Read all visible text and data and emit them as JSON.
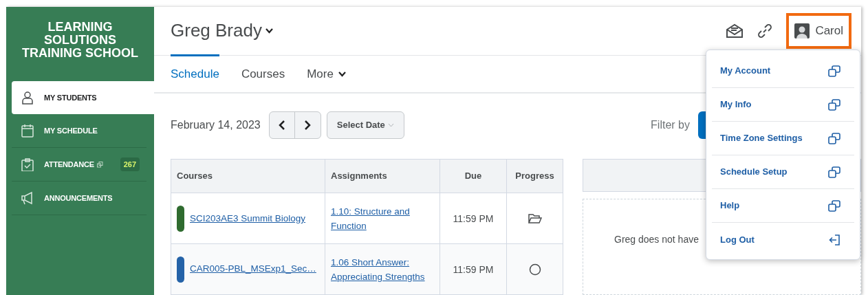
{
  "sidebar": {
    "logo": "LEARNING SOLUTIONS TRAINING SCHOOL",
    "items": [
      {
        "label": "MY STUDENTS",
        "kind": "person",
        "selected": true
      },
      {
        "label": "MY SCHEDULE",
        "kind": "calendar",
        "selected": false
      },
      {
        "label": "ATTENDANCE",
        "kind": "clipboard",
        "selected": false,
        "external": true,
        "badge": "267"
      },
      {
        "label": "ANNOUNCEMENTS",
        "kind": "megaphone",
        "selected": false
      }
    ]
  },
  "header": {
    "student": "Greg Brady",
    "user": "Carol",
    "user_highlighted": true
  },
  "tabs": [
    {
      "label": "Schedule",
      "selected": true,
      "dropdown": false
    },
    {
      "label": "Courses",
      "selected": false,
      "dropdown": false
    },
    {
      "label": "More",
      "selected": false,
      "dropdown": true
    }
  ],
  "toolbar": {
    "date": "February 14, 2023",
    "select_date": "Select Date",
    "filter_label": "Filter by"
  },
  "table": {
    "columns": [
      "Courses",
      "Assignments",
      "Due",
      "Progress"
    ],
    "rows": [
      {
        "course": "SCI203AE3 Summit Biology",
        "color": "#2f6b2f",
        "assignment": "1.10: Structure and Function",
        "due": "11:59 PM",
        "kind": "folder"
      },
      {
        "course": "CAR005-PBL_MSExp1_Sec…",
        "color": "#2563a8",
        "assignment": "1.06 Short Answer: Appreciating Strengths",
        "due": "11:59 PM",
        "kind": "circle"
      }
    ]
  },
  "empty_message": "Greg does not have",
  "menu": [
    {
      "label": "My Account",
      "kind": "external"
    },
    {
      "label": "My Info",
      "kind": "external"
    },
    {
      "label": "Time Zone Settings",
      "kind": "external"
    },
    {
      "label": "Schedule Setup",
      "kind": "external"
    },
    {
      "label": "Help",
      "kind": "external"
    },
    {
      "label": "Log Out",
      "kind": "logout"
    }
  ]
}
